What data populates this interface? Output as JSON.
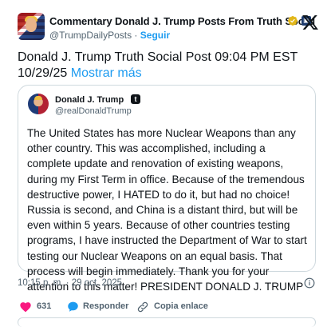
{
  "header": {
    "display_name": "Commentary Donald J. Trump Posts From Truth Social",
    "handle": "@TrumpDailyPosts",
    "separator": " · ",
    "follow_label": "Seguir"
  },
  "post": {
    "text": "Donald J. Trump Truth Social Post 09:04 PM EST 10/29/25",
    "show_more": "Mostrar más"
  },
  "quote": {
    "name": "Donald J. Trump",
    "badge": "t",
    "handle": "@realDonaldTrump",
    "body": "The United States has more Nuclear Weapons than any other country. This was accomplished, including a complete update and renovation of existing weapons, during my First Term in office. Because of the tremendous destructive power, I HATED to do it, but had no choice! Russia is second, and China is a distant third, but will be even within 5 years. Because of other countries testing programs, I have instructed the Department of War to start testing our Nuclear Weapons on an equal basis. That process will begin immediately. Thank you for your attention to this matter! PRESIDENT DONALD J. TRUMP"
  },
  "meta": {
    "timestamp": "10:15 p. m. · 29 oct. 2025"
  },
  "actions": {
    "like_count": "631",
    "reply_label": "Responder",
    "copy_link_label": "Copia enlace"
  },
  "colors": {
    "accent": "#1d9bf0",
    "like": "#f91880",
    "text": "#0f1419",
    "secondary": "#536471",
    "border": "#cfd9de",
    "verified_gold": "#e2b719"
  },
  "icons": [
    "verified-gold-badge-icon",
    "affiliate-badge-icon",
    "x-logo-icon",
    "info-icon",
    "heart-icon",
    "reply-bubble-icon",
    "link-icon"
  ]
}
